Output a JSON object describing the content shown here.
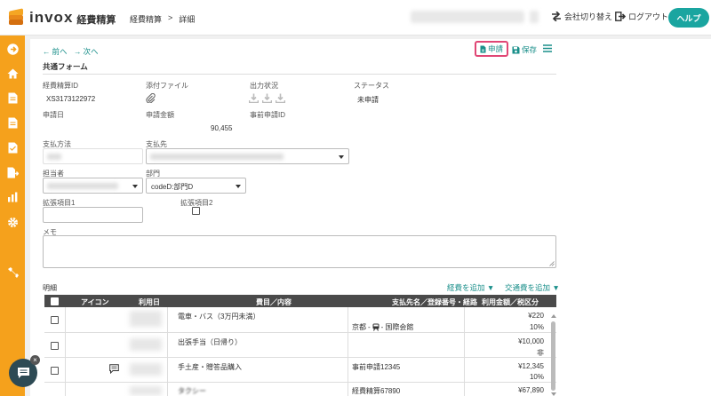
{
  "app": {
    "logo_text": "invox",
    "logo_sub": "経費精算"
  },
  "breadcrumb": {
    "item1": "経費精算",
    "sep": ">",
    "item2": "詳細"
  },
  "header": {
    "switch_company": "会社切り替え",
    "logout": "ログアウト",
    "help": "ヘルプ"
  },
  "nav": {
    "prev": "前へ",
    "next": "次へ"
  },
  "actions": {
    "apply": "申請",
    "save": "保存"
  },
  "form": {
    "title": "共通フォーム",
    "id_label": "経費精算ID",
    "id_value": "XS3173122972",
    "attach_label": "添付ファイル",
    "output_label": "出力状況",
    "status_label": "ステータス",
    "status_value": "未申請",
    "apply_date_label": "申請日",
    "amount_label": "申請金額",
    "amount_value": "90,455",
    "prior_label": "事前申請ID",
    "pay_method_label": "支払方法",
    "payee_label": "支払先",
    "person_label": "担当者",
    "dept_label": "部門",
    "dept_value": "codeD:部門D",
    "ext1_label": "拡張項目1",
    "ext2_label": "拡張項目2",
    "memo_label": "メモ"
  },
  "detail": {
    "label": "明細",
    "add_expense": "経費を追加 ▼",
    "add_transport": "交通費を追加 ▼",
    "headers": {
      "icon": "アイコン",
      "date": "利用日",
      "item": "費目／内容",
      "payee": "支払先名／登録番号・経路",
      "amount": "利用金額／税区分"
    },
    "rows": [
      {
        "item": "電車・バス（3万円未満）",
        "route_from": "京都",
        "route_to": "国際会館",
        "amount": "¥220",
        "tax": "10%"
      },
      {
        "item": "出張手当（日帰り）",
        "route_from": "",
        "route_to": "",
        "amount": "¥10,000",
        "tax": "非"
      },
      {
        "item": "手土産・贈答品購入",
        "payee": "事前申請12345",
        "amount": "¥12,345",
        "tax": "10%"
      },
      {
        "item": "タクシー",
        "payee": "経費精算67890",
        "amount": "¥67,890",
        "tax": ""
      }
    ]
  }
}
